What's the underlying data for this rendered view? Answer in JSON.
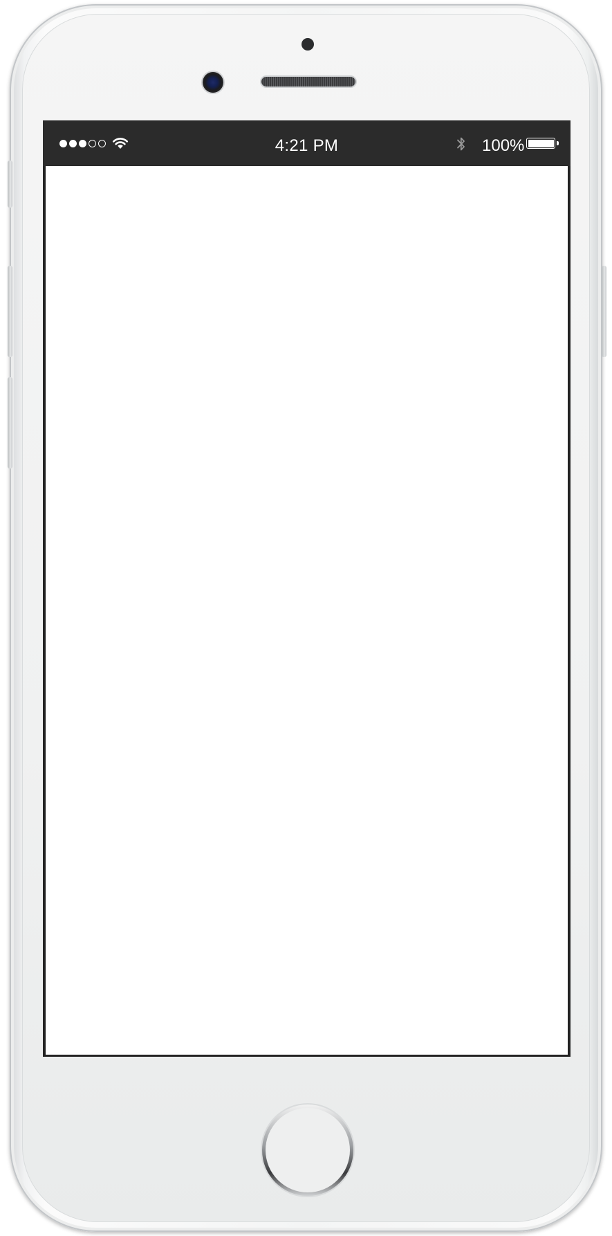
{
  "status_bar": {
    "signal_strength": {
      "filled": 3,
      "total": 5
    },
    "wifi_icon": "wifi-icon",
    "time": "4:21 PM",
    "bluetooth_icon": "bluetooth-icon",
    "battery_percent_label": "100%",
    "battery_level": 1.0
  },
  "device": {
    "color": "#f4f5f5",
    "screen_background": "#ffffff",
    "status_bar_background": "#2b2b2b"
  }
}
